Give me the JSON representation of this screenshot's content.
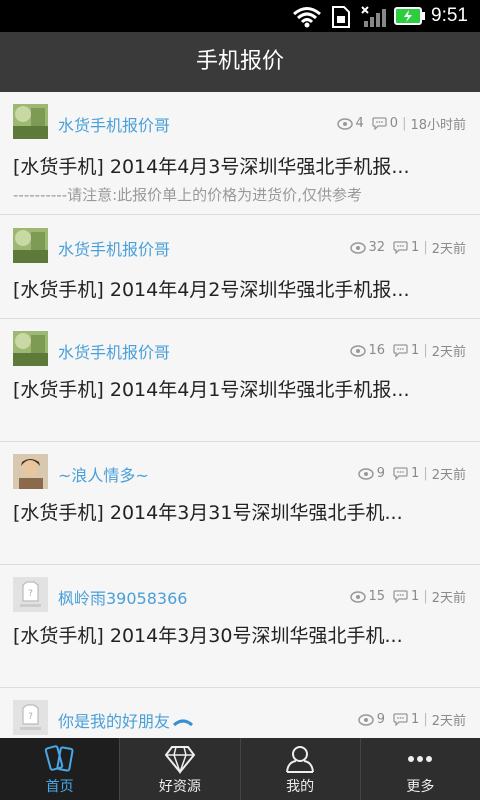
{
  "status": {
    "time": "9:51"
  },
  "header": {
    "title": "手机报价"
  },
  "posts": [
    {
      "author": "水货手机报价哥",
      "views": "4",
      "comments": "0",
      "time": "18小时前",
      "title": "[水货手机] 2014年4月3号深圳华强北手机报...",
      "note": "----------请注意:此报价单上的价格为进货价,仅供参考",
      "avatar": "photo"
    },
    {
      "author": "水货手机报价哥",
      "views": "32",
      "comments": "1",
      "time": "2天前",
      "title": "[水货手机] 2014年4月2号深圳华强北手机报...",
      "note": "",
      "avatar": "photo"
    },
    {
      "author": "水货手机报价哥",
      "views": "16",
      "comments": "1",
      "time": "2天前",
      "title": "[水货手机] 2014年4月1号深圳华强北手机报...",
      "note": "",
      "avatar": "photo"
    },
    {
      "author": "~浪人情多~",
      "views": "9",
      "comments": "1",
      "time": "2天前",
      "title": "[水货手机] 2014年3月31号深圳华强北手机...",
      "note": "",
      "avatar": "person"
    },
    {
      "author": "枫岭雨39058366",
      "views": "15",
      "comments": "1",
      "time": "2天前",
      "title": "[水货手机] 2014年3月30号深圳华强北手机...",
      "note": "",
      "avatar": "default"
    },
    {
      "author": "你是我的好朋友",
      "views": "9",
      "comments": "1",
      "time": "2天前",
      "title": "",
      "note": "",
      "avatar": "default"
    }
  ],
  "tabs": [
    {
      "label": "首页",
      "icon": "phones-icon",
      "active": true
    },
    {
      "label": "好资源",
      "icon": "diamond-icon",
      "active": false
    },
    {
      "label": "我的",
      "icon": "user-icon",
      "active": false
    },
    {
      "label": "更多",
      "icon": "more-icon",
      "active": false
    }
  ]
}
